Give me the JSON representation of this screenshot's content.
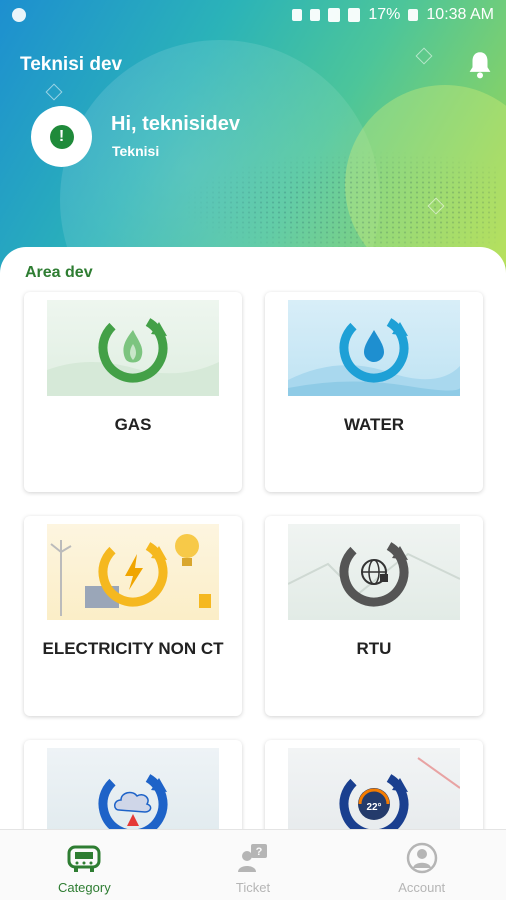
{
  "status_bar": {
    "battery": "17%",
    "time": "10:38 AM"
  },
  "header": {
    "title": "Teknisi dev",
    "greeting": "Hi, teknisidev",
    "role": "Teknisi",
    "avatar_icon": "exclamation-icon",
    "bell_icon": "bell-icon"
  },
  "section": {
    "title": "Area dev"
  },
  "categories": [
    {
      "label": "GAS",
      "icon": "flame-refresh-icon",
      "accent": "#43a047"
    },
    {
      "label": "WATER",
      "icon": "water-drop-refresh-icon",
      "accent": "#1ea0d6"
    },
    {
      "label": "ELECTRICITY NON CT",
      "icon": "lightning-refresh-icon",
      "accent": "#f5b81f"
    },
    {
      "label": "RTU",
      "icon": "globe-refresh-icon",
      "accent": "#555555"
    },
    {
      "label": "",
      "icon": "cloud-refresh-icon",
      "accent": "#1e63c8"
    },
    {
      "label": "",
      "icon": "gauge-refresh-icon",
      "accent": "#1a3f8f"
    }
  ],
  "bottom_nav": [
    {
      "label": "Category",
      "icon": "meter-icon",
      "active": true
    },
    {
      "label": "Ticket",
      "icon": "ticket-user-icon",
      "active": false
    },
    {
      "label": "Account",
      "icon": "account-icon",
      "active": false
    }
  ],
  "colors": {
    "primary": "#2e7d32",
    "header_gradient_start": "#1d8fd0",
    "header_gradient_end": "#a8d94a"
  }
}
